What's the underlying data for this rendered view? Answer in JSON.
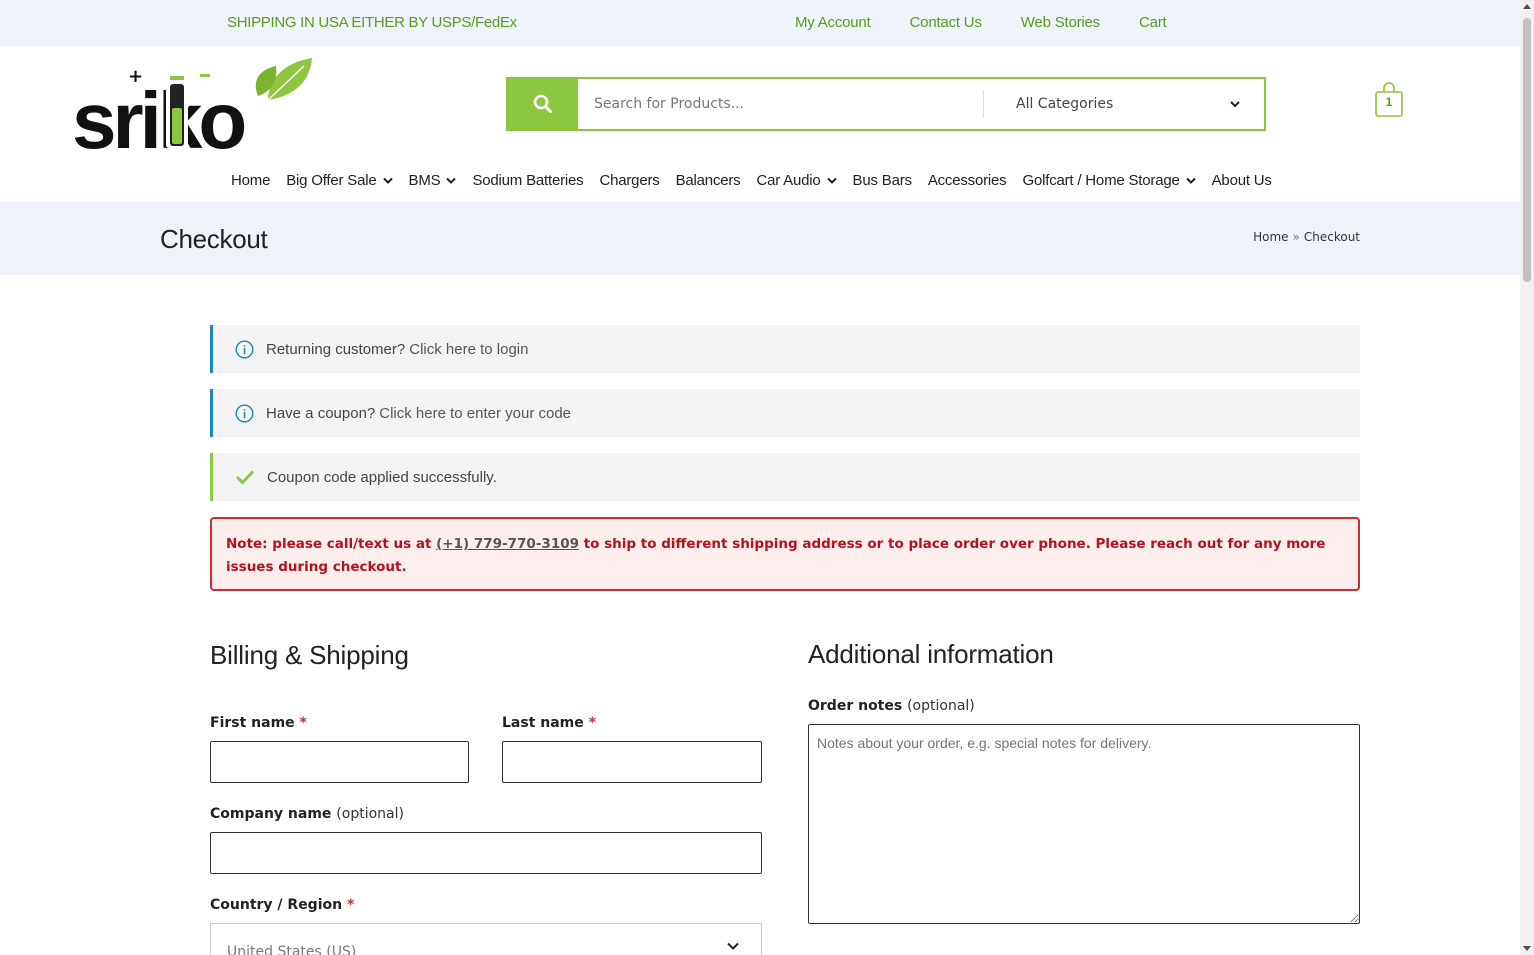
{
  "topbar": {
    "shipping_text": "SHIPPING IN USA EITHER BY USPS/FedEx",
    "links": [
      "My Account",
      "Contact Us",
      "Web Stories",
      "Cart"
    ]
  },
  "header": {
    "logo_text": "sriko",
    "search_placeholder": "Search for Products...",
    "category_selected": "All Categories",
    "cart_count": "1"
  },
  "nav": {
    "items": [
      {
        "label": "Home",
        "dropdown": false
      },
      {
        "label": "Big Offer Sale",
        "dropdown": true
      },
      {
        "label": "BMS",
        "dropdown": true
      },
      {
        "label": "Sodium Batteries",
        "dropdown": false
      },
      {
        "label": "Chargers",
        "dropdown": false
      },
      {
        "label": "Balancers",
        "dropdown": false
      },
      {
        "label": "Car Audio",
        "dropdown": true
      },
      {
        "label": "Bus Bars",
        "dropdown": false
      },
      {
        "label": "Accessories",
        "dropdown": false
      },
      {
        "label": "Golfcart / Home Storage",
        "dropdown": true
      },
      {
        "label": "About Us",
        "dropdown": false
      }
    ]
  },
  "page": {
    "title": "Checkout",
    "breadcrumb": {
      "home": "Home",
      "separator": "»",
      "current": "Checkout"
    }
  },
  "notices": {
    "login_prefix": "Returning customer?",
    "login_link": "Click here to login",
    "coupon_prefix": "Have a coupon?",
    "coupon_link": "Click here to enter your code",
    "coupon_success": "Coupon code applied successfully."
  },
  "alert": {
    "before": "Note: please call/text us at ",
    "phone": "(+1) 779-770-3109",
    "after": " to ship to different shipping address or to place order over phone. Please reach out for any more issues during checkout."
  },
  "billing": {
    "heading": "Billing & Shipping",
    "first_name_label": "First name",
    "last_name_label": "Last name",
    "company_label": "Company name",
    "optional": "(optional)",
    "required_mark": "*",
    "country_label": "Country / Region",
    "country_value": "United States (US)"
  },
  "additional": {
    "heading": "Additional information",
    "notes_label": "Order notes",
    "notes_placeholder": "Notes about your order, e.g. special notes for delivery."
  },
  "colors": {
    "brand_green": "#8dc63f",
    "link_green": "#5d9a1e",
    "info_blue": "#1e85be",
    "alert_red": "#cf2e2e"
  }
}
